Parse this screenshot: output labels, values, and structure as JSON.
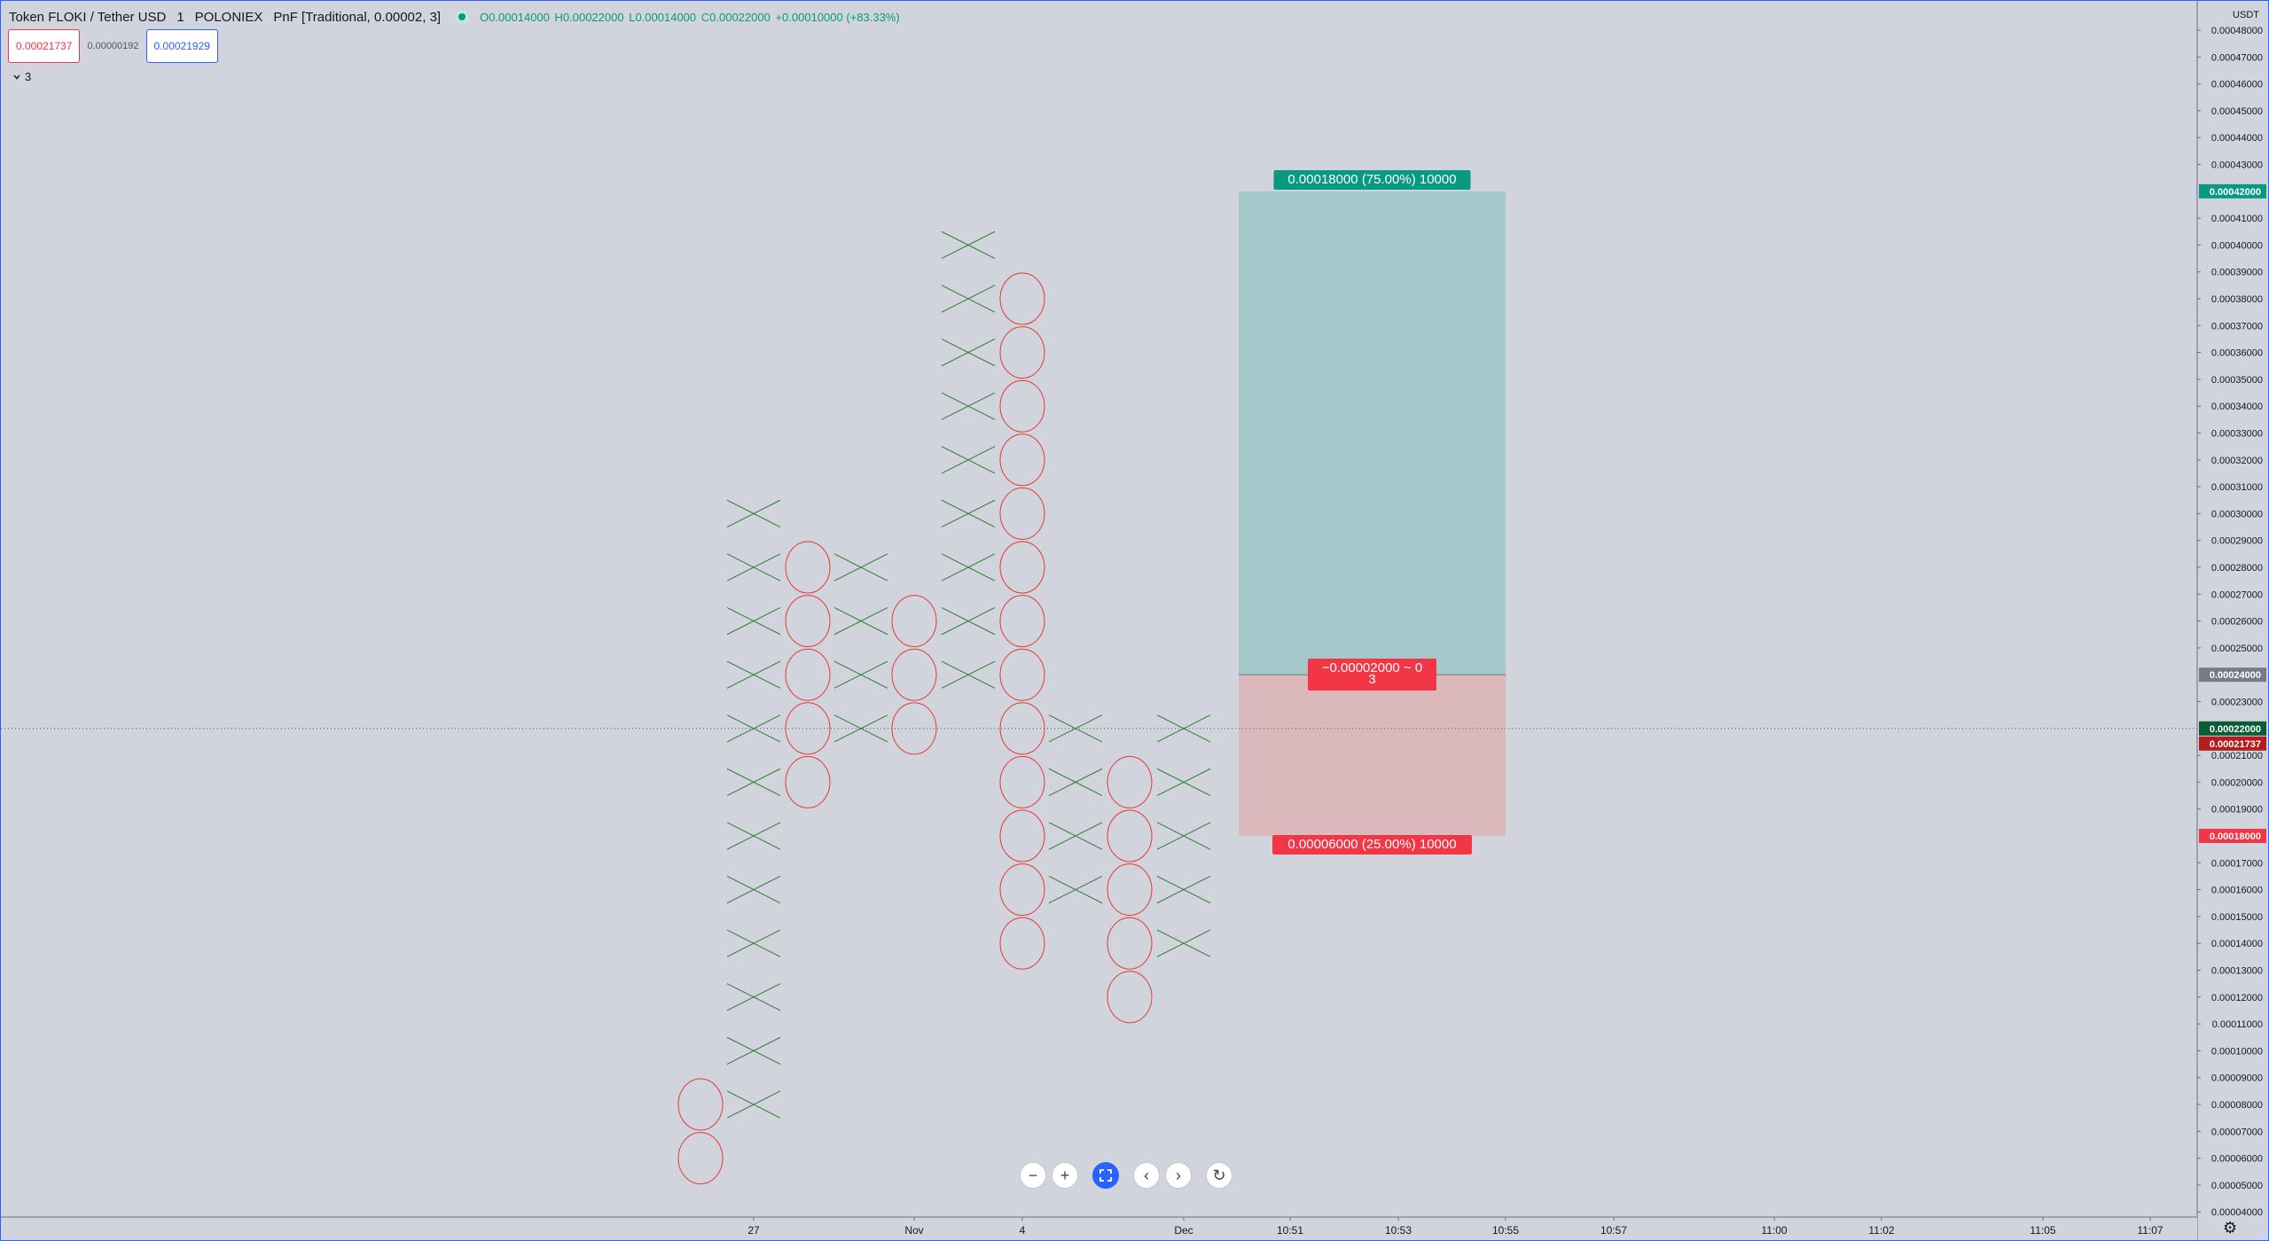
{
  "legend": {
    "symbol": "Token FLOKI / Tether USD",
    "interval": "1",
    "exchange": "POLONIEX",
    "chart_style": "PnF [Traditional, 0.00002, 3]",
    "open": "O0.00014000",
    "high": "H0.00022000",
    "low": "L0.00014000",
    "close": "C0.00022000",
    "change": "+0.00010000 (+83.33%)",
    "status_color": "#089981"
  },
  "trade": {
    "sell_price": "0.00021737",
    "spread": "0.00000192",
    "buy_price": "0.00021929"
  },
  "indicator_toggle": {
    "count": "3",
    "icon": "chevron-down-icon"
  },
  "axis": {
    "currency": "USDT",
    "tick_labels": [
      "0.00048000",
      "0.00047000",
      "0.00046000",
      "0.00045000",
      "0.00044000",
      "0.00043000",
      "0.00041000",
      "0.00040000",
      "0.00039000",
      "0.00038000",
      "0.00037000",
      "0.00036000",
      "0.00035000",
      "0.00034000",
      "0.00033000",
      "0.00032000",
      "0.00031000",
      "0.00030000",
      "0.00029000",
      "0.00028000",
      "0.00027000",
      "0.00026000",
      "0.00025000",
      "0.00023000",
      "0.00021000",
      "0.00020000",
      "0.00019000",
      "0.00017000",
      "0.00016000",
      "0.00015000",
      "0.00014000",
      "0.00013000",
      "0.00012000",
      "0.00011000",
      "0.00010000",
      "0.00009000",
      "0.00008000",
      "0.00007000",
      "0.00006000",
      "0.00005000",
      "0.00004000"
    ],
    "x_labels": [
      "27",
      "Nov",
      "4",
      "Dec",
      "10:51",
      "10:53",
      "10:55",
      "10:57",
      "11:00",
      "11:02",
      "11:05",
      "11:07"
    ],
    "badges": [
      {
        "price": 0.00042,
        "text": "0.00042000",
        "color": "#089981"
      },
      {
        "price": 0.00024,
        "text": "0.00024000",
        "color": "#787b86"
      },
      {
        "price": 0.00022,
        "text": "0.00022000",
        "color": "#0a5c36"
      },
      {
        "price": 0.00021737,
        "text": "0.00021737",
        "color": "#b71c1c"
      },
      {
        "price": 0.00018,
        "text": "0.00018000",
        "color": "#f23645"
      }
    ]
  },
  "position": {
    "target_label": "0.00018000 (75.00%) 10000",
    "entry_label_line1": "−0.00002000 ~ 0",
    "entry_label_line2": "3",
    "stop_label": "0.00006000 (25.00%) 10000",
    "profit_color": "#a5c9ca",
    "loss_color": "#dab8bc"
  },
  "toolbar": {
    "zoom_out": "−",
    "zoom_in": "+",
    "reset_view": "⟳",
    "scroll_left": "‹",
    "scroll_right": "›",
    "reset": "↻",
    "settings": "⚙"
  },
  "colors": {
    "x": "#2e7d32",
    "o": "#e53935"
  },
  "chart_data": {
    "type": "point-and-figure",
    "box_size": 2e-05,
    "reversal": 3,
    "columns": [
      {
        "type": "O",
        "low": 6e-05,
        "high": 8e-05
      },
      {
        "type": "X",
        "low": 8e-05,
        "high": 0.0003
      },
      {
        "type": "O",
        "low": 0.0002,
        "high": 0.00028
      },
      {
        "type": "X",
        "low": 0.00022,
        "high": 0.00028
      },
      {
        "type": "O",
        "low": 0.00022,
        "high": 0.00026
      },
      {
        "type": "X",
        "low": 0.00024,
        "high": 0.0004
      },
      {
        "type": "O",
        "low": 0.00014,
        "high": 0.00038
      },
      {
        "type": "X",
        "low": 0.00016,
        "high": 0.00022
      },
      {
        "type": "O",
        "low": 0.00012,
        "high": 0.0002
      },
      {
        "type": "X",
        "low": 0.00014,
        "high": 0.00022
      }
    ],
    "last_price": 0.00022,
    "long_position": {
      "entry": 0.00024,
      "target": 0.00042,
      "stop": 0.00018
    },
    "ylim": [
      4e-05,
      0.00048
    ]
  }
}
